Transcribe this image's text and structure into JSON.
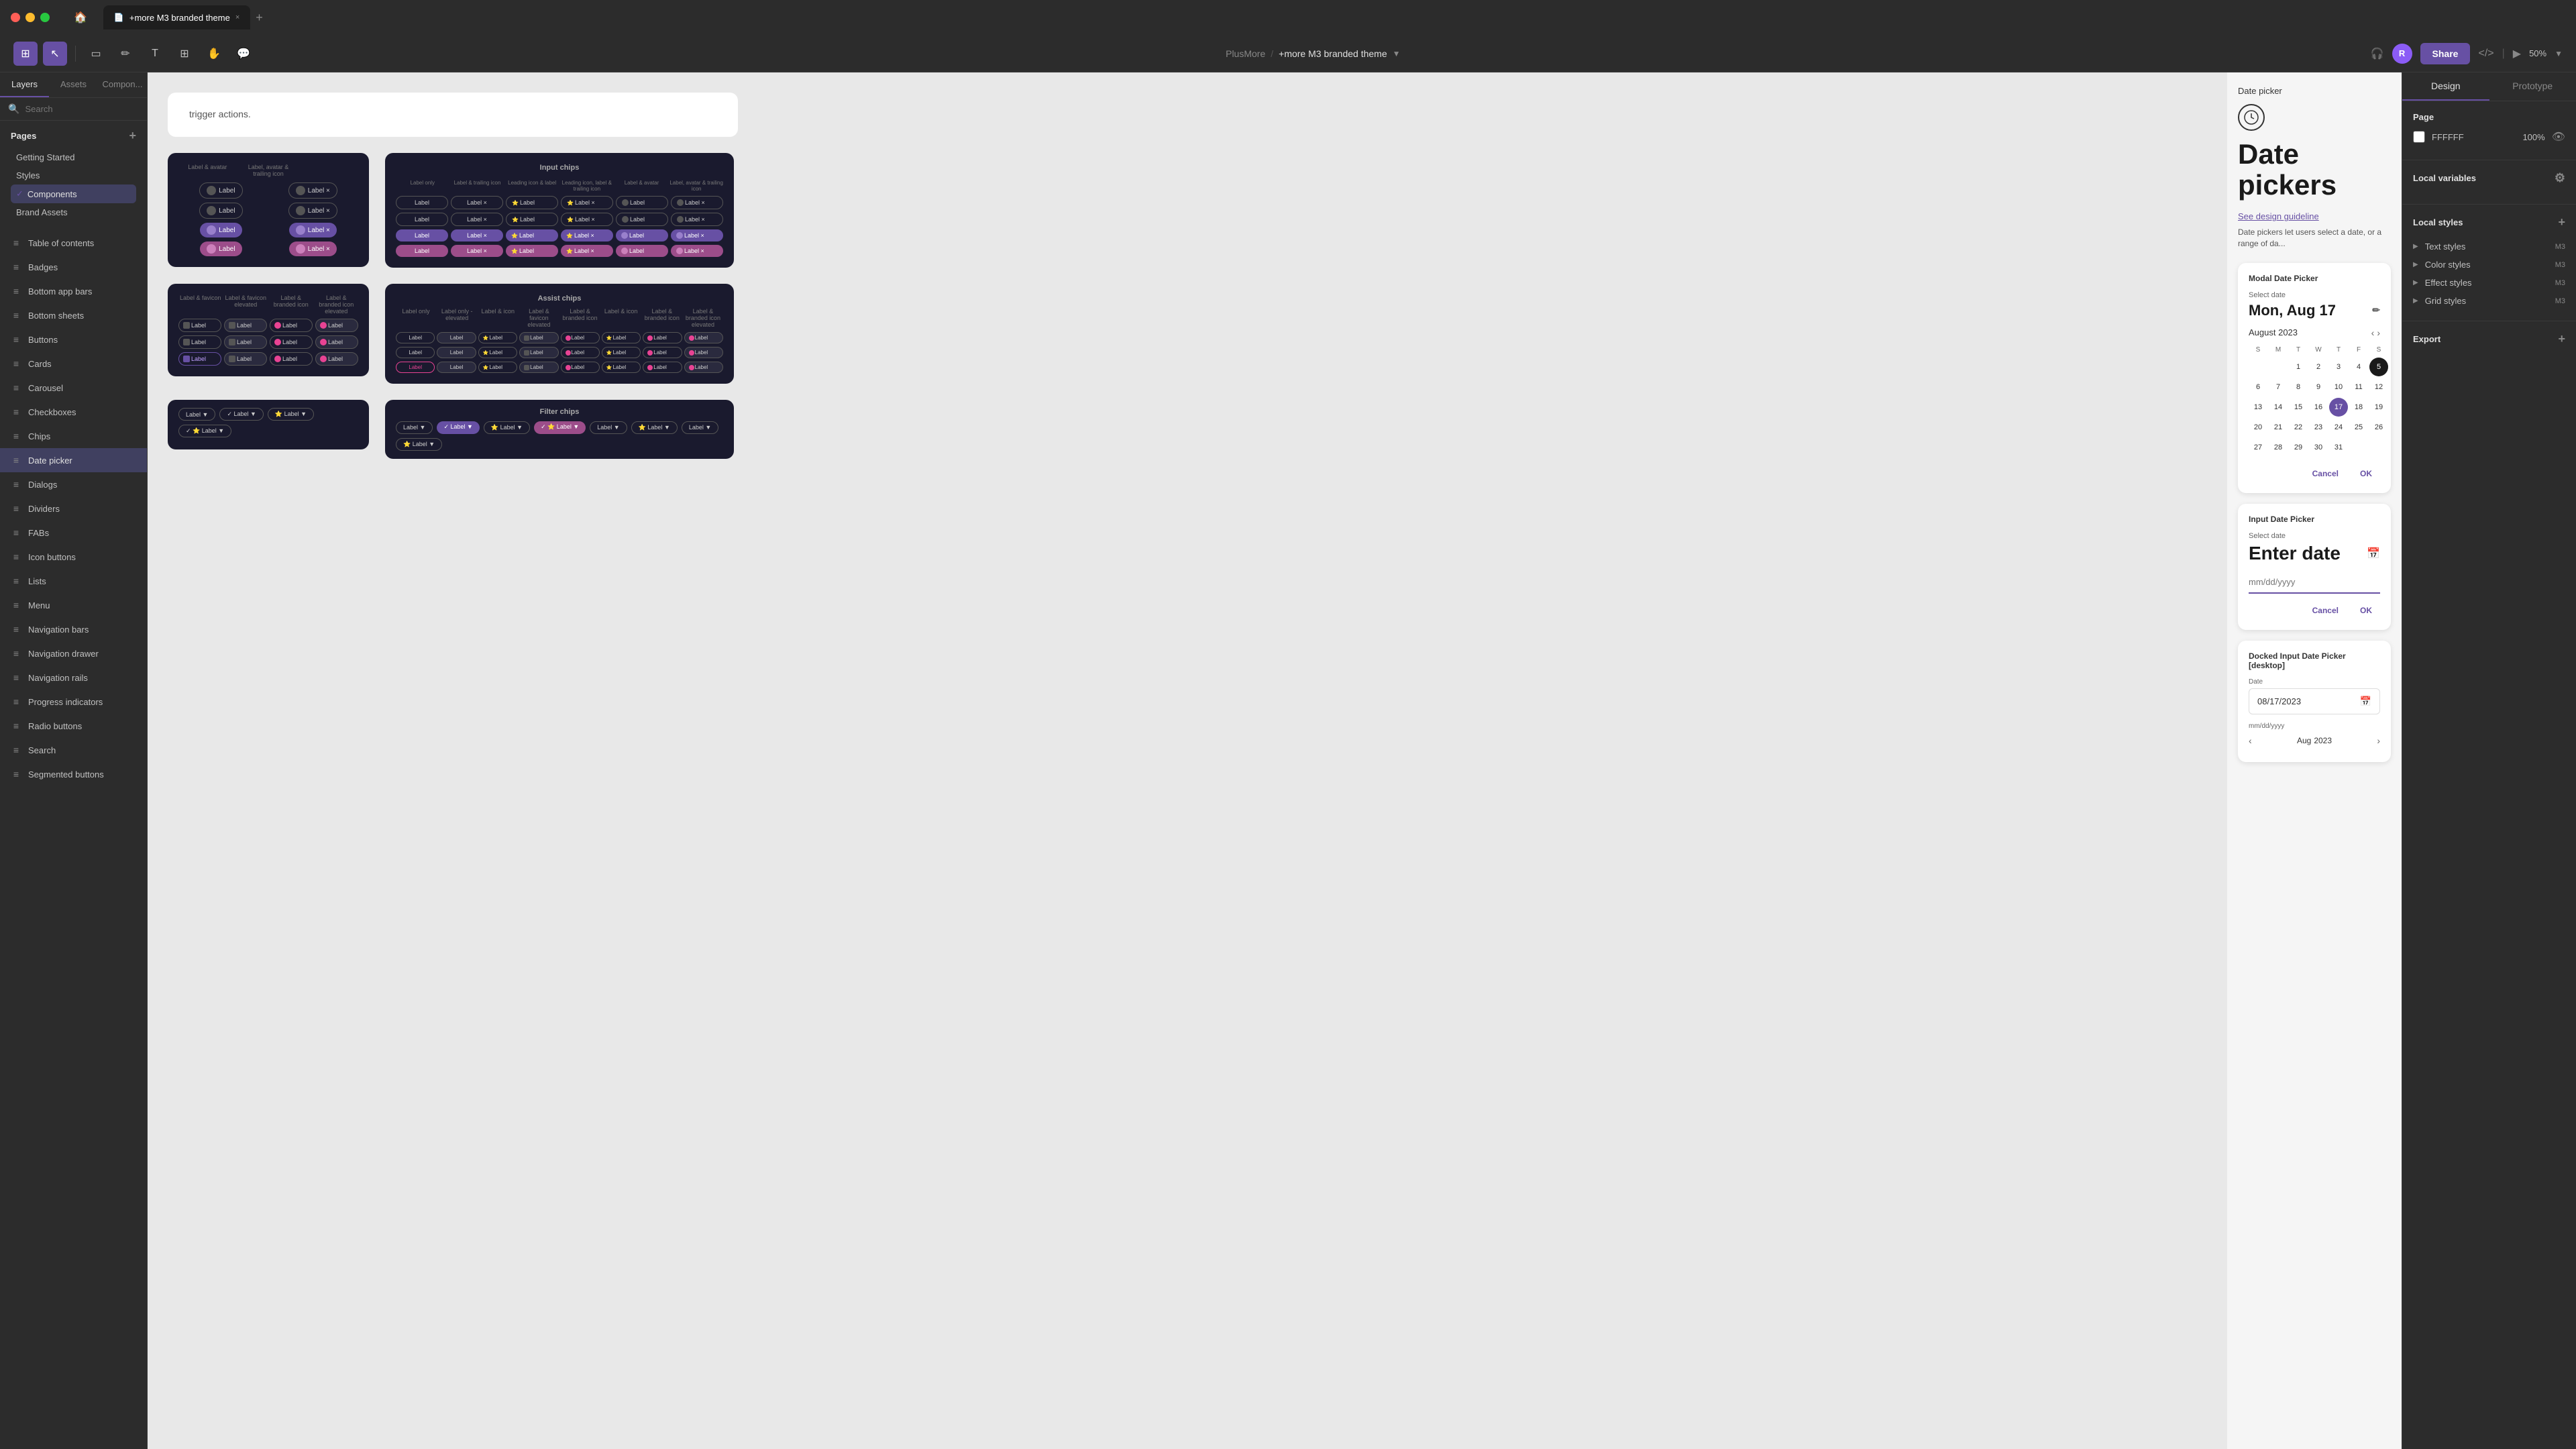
{
  "titlebar": {
    "tab_label": "+more M3 branded theme",
    "tab_close": "×",
    "tab_add": "+",
    "home": "⌂"
  },
  "toolbar": {
    "menu_icon": "☰",
    "move_icon": "↖",
    "frame_icon": "▭",
    "pen_icon": "✏",
    "text_icon": "T",
    "component_icon": "⊞",
    "hand_icon": "✋",
    "comment_icon": "💬",
    "breadcrumb_left": "PlusMore",
    "breadcrumb_sep": "/",
    "breadcrumb_right": "+more M3 branded theme",
    "share_label": "Share",
    "zoom_level": "50%"
  },
  "left_panel": {
    "tabs": [
      "Layers",
      "Assets",
      "Compon..."
    ],
    "search_placeholder": "Search",
    "pages_title": "Pages",
    "pages": [
      {
        "label": "Getting Started",
        "active": false
      },
      {
        "label": "Styles",
        "active": false
      },
      {
        "label": "Components",
        "active": true
      },
      {
        "label": "Brand Assets",
        "active": false
      }
    ],
    "nav_items": [
      {
        "icon": "≡",
        "label": "Table of contents"
      },
      {
        "icon": "≡",
        "label": "Badges"
      },
      {
        "icon": "≡",
        "label": "Bottom app bars"
      },
      {
        "icon": "≡",
        "label": "Bottom sheets"
      },
      {
        "icon": "≡",
        "label": "Buttons"
      },
      {
        "icon": "≡",
        "label": "Cards"
      },
      {
        "icon": "≡",
        "label": "Carousel"
      },
      {
        "icon": "≡",
        "label": "Checkboxes"
      },
      {
        "icon": "≡",
        "label": "Chips"
      },
      {
        "icon": "≡",
        "label": "Date picker",
        "active": true
      },
      {
        "icon": "≡",
        "label": "Dialogs"
      },
      {
        "icon": "≡",
        "label": "Dividers"
      },
      {
        "icon": "≡",
        "label": "FABs"
      },
      {
        "icon": "≡",
        "label": "Icon buttons"
      },
      {
        "icon": "≡",
        "label": "Lists"
      },
      {
        "icon": "≡",
        "label": "Menu"
      },
      {
        "icon": "≡",
        "label": "Navigation bars"
      },
      {
        "icon": "≡",
        "label": "Navigation drawer"
      },
      {
        "icon": "≡",
        "label": "Navigation rails"
      },
      {
        "icon": "≡",
        "label": "Progress indicators"
      },
      {
        "icon": "≡",
        "label": "Radio buttons"
      },
      {
        "icon": "≡",
        "label": "Search"
      },
      {
        "icon": "≡",
        "label": "Segmented buttons"
      }
    ]
  },
  "right_panel": {
    "tabs": [
      "Design",
      "Prototype"
    ],
    "page_section": {
      "title": "Page",
      "color": "FFFFFF",
      "opacity": "100%"
    },
    "local_variables": {
      "title": "Local variables"
    },
    "local_styles": {
      "title": "Local styles"
    },
    "text_styles": {
      "title": "Text styles",
      "item": "M3"
    },
    "color_styles": {
      "title": "Color styles",
      "item": "M3"
    },
    "effect_styles": {
      "title": "Effect styles",
      "item": "M3"
    },
    "grid_styles": {
      "title": "Grid styles",
      "item": "M3"
    },
    "export": {
      "title": "Export"
    }
  },
  "date_picker_preview": {
    "section_label": "Date picker",
    "logo_symbol": "⊕",
    "title": "Date pickers",
    "link": "See design guideline",
    "description": "Date pickers let users select a date, or a range of da...",
    "modal": {
      "title": "Modal Date Picker",
      "select_date_label": "Select date",
      "selected_date": "Mon, Aug 17",
      "month_year": "August 2023",
      "weekdays": [
        "S",
        "M",
        "T",
        "W",
        "T",
        "F",
        "S"
      ],
      "weeks": [
        [
          "",
          "",
          "1",
          "2",
          "3",
          "4",
          "5"
        ],
        [
          "6",
          "7",
          "8",
          "9",
          "10",
          "11",
          "12"
        ],
        [
          "13",
          "14",
          "15",
          "16",
          "17",
          "18",
          "19"
        ],
        [
          "20",
          "21",
          "22",
          "23",
          "24",
          "25",
          "26"
        ],
        [
          "27",
          "28",
          "29",
          "30",
          "31",
          "",
          ""
        ]
      ],
      "selected_day": "17",
      "cancel_label": "Cancel",
      "ok_label": "OK"
    },
    "input_dp": {
      "title": "Input Date Picker",
      "label": "Select date",
      "value": "Enter date",
      "placeholder": "mm/dd/yyyy"
    },
    "docked_dp": {
      "title": "Docked Input Date Picker [desktop]",
      "value": "08/17/2023",
      "placeholder": "mm/dd/yyyy",
      "month": "Aug",
      "year": "2023"
    }
  },
  "canvas": {
    "info_text": "trigger actions.",
    "frames": [
      {
        "label": "Input chips",
        "type": "dark"
      },
      {
        "label": "Assist chips",
        "type": "dark"
      },
      {
        "label": "Filter chips",
        "type": "dark"
      }
    ]
  }
}
